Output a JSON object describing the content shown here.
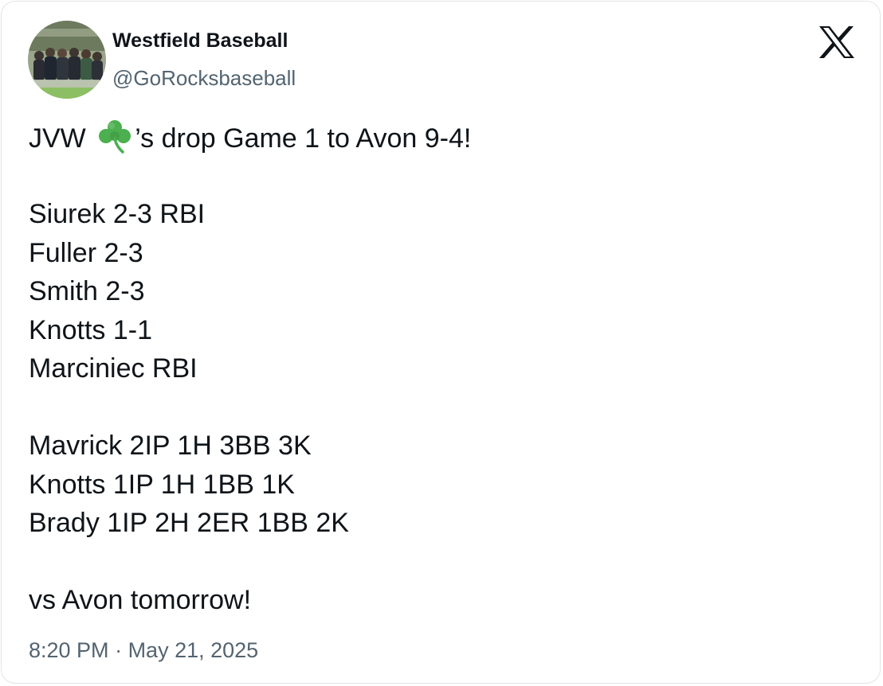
{
  "author": {
    "display_name": "Westfield Baseball",
    "handle": "@GoRocksbaseball"
  },
  "brand_icon": "x-logo-icon",
  "tweet": {
    "headline": {
      "before_emoji": "JVW",
      "emoji": "shamrock",
      "after_emoji": "’s drop Game 1 to Avon 9-4!"
    },
    "batting": [
      "Siurek 2-3 RBI",
      "Fuller 2-3",
      "Smith 2-3",
      "Knotts 1-1",
      "Marciniec RBI"
    ],
    "pitching": [
      "Mavrick 2IP 1H 3BB 3K",
      "Knotts 1IP 1H 1BB 1K",
      "Brady 1IP 2H 2ER 1BB 2K"
    ],
    "closing": "vs Avon tomorrow!"
  },
  "timestamp": {
    "time": "8:20 PM",
    "separator": " · ",
    "date": "May 21, 2025"
  },
  "colors": {
    "text_primary": "#0f1419",
    "text_secondary": "#536471",
    "shamrock_green": "#4caf50",
    "card_border": "#e1e4e8"
  }
}
